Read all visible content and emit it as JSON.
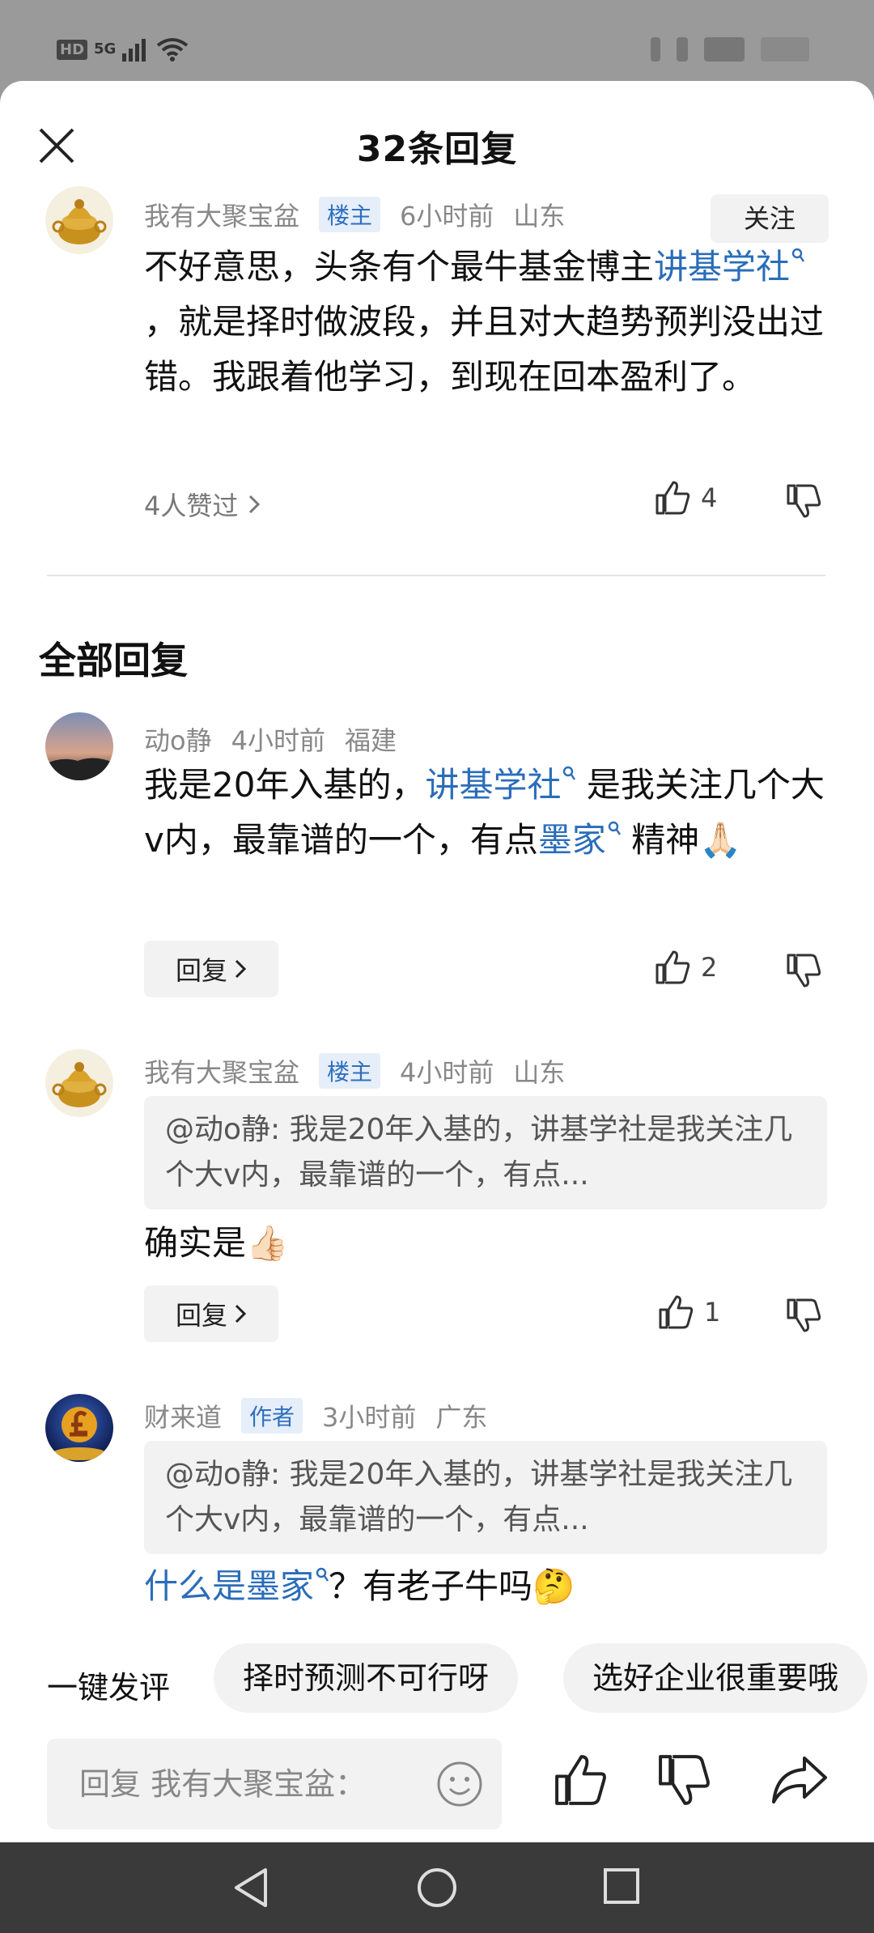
{
  "status_bar": {
    "hd": "HD",
    "network": "5G"
  },
  "header": {
    "title": "32条回复"
  },
  "main_comment": {
    "author": "我有大聚宝盆",
    "badge": "楼主",
    "time": "6小时前",
    "location": "山东",
    "follow_label": "关注",
    "text_1": "不好意思，头条有个最牛基金博主",
    "link_1": "讲基学社",
    "text_2": "，就是择时做波段，并且对大趋势预判没出过错。我跟着他学习，到现在回本盈利了。",
    "likers": "4人赞过",
    "likes": "4"
  },
  "section": {
    "title": "全部回复"
  },
  "replies": [
    {
      "author": "动o静",
      "time": "4小时前",
      "location": "福建",
      "text_1": "我是20年入基的，",
      "link_1": "讲基学社",
      "text_2": "是我关注几个大v内，最靠谱的一个，有点",
      "link_2": "墨家",
      "text_3": "精神",
      "emoji": "🙏🏻",
      "reply_label": "回复",
      "likes": "2"
    },
    {
      "author": "我有大聚宝盆",
      "badge": "楼主",
      "time": "4小时前",
      "location": "山东",
      "quote": "@动o静: 我是20年入基的，讲基学社是我关注几个大v内，最靠谱的一个，有点...",
      "text_1": "确实是",
      "emoji": "👍🏻",
      "reply_label": "回复",
      "likes": "1"
    },
    {
      "author": "财来道",
      "badge": "作者",
      "time": "3小时前",
      "location": "广东",
      "quote": "@动o静: 我是20年入基的，讲基学社是我关注几个大v内，最靠谱的一个，有点...",
      "link_1": "什么是墨家",
      "text_1": "？有老子牛吗",
      "emoji": "🤔"
    }
  ],
  "quick_reply": {
    "label": "一键发评",
    "chips": [
      "择时预测不可行呀",
      "选好企业很重要哦"
    ]
  },
  "composer": {
    "placeholder": "回复 我有大聚宝盆："
  },
  "colors": {
    "link": "#2a6db9",
    "badge_bg": "#e6eef9",
    "badge_text": "#2f6fbf"
  }
}
